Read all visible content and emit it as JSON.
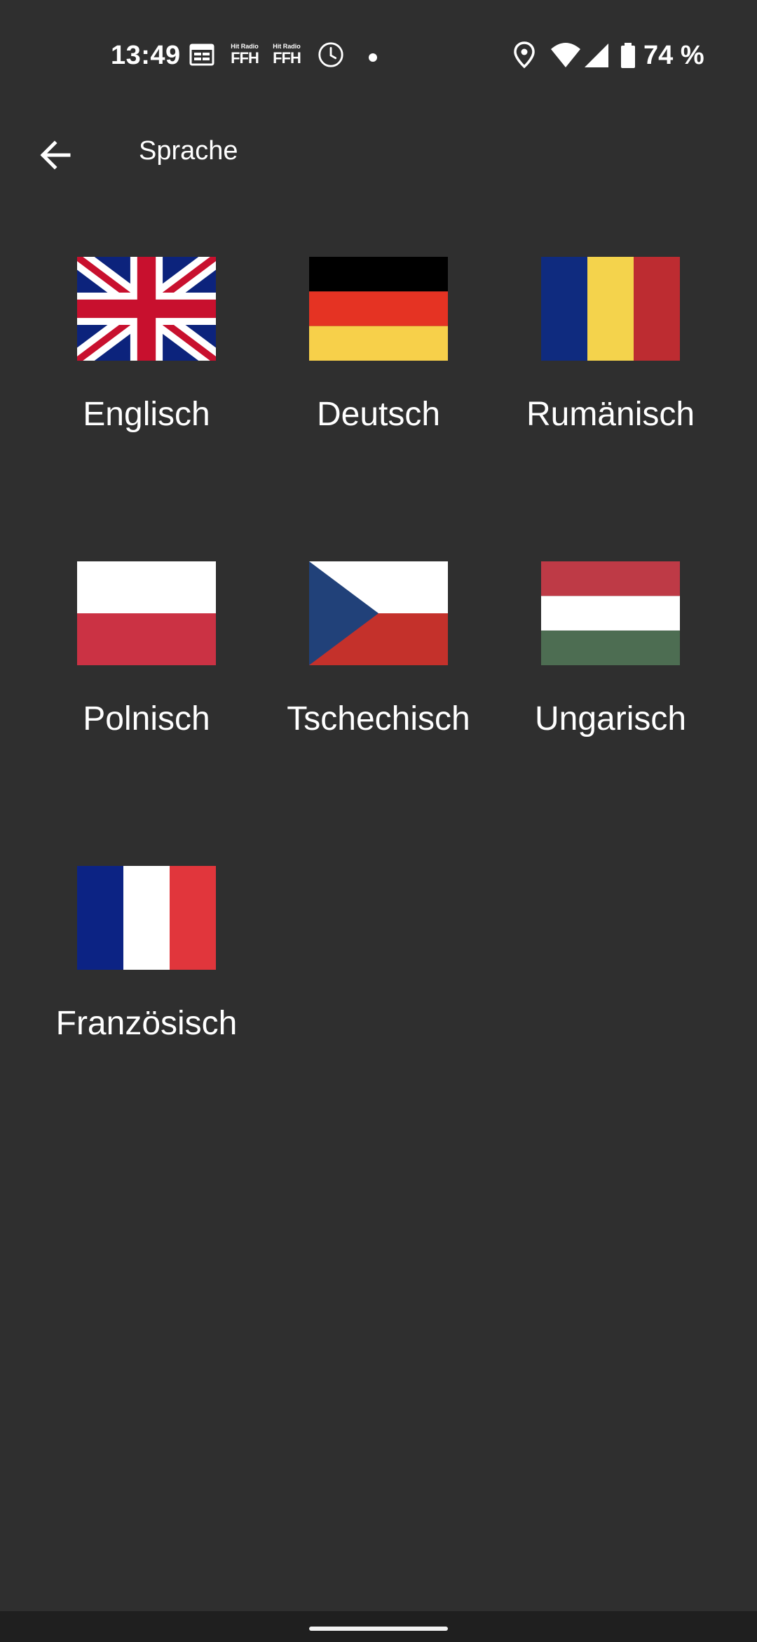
{
  "status_bar": {
    "time": "13:49",
    "notification_icons": [
      "calendar-icon",
      "hit-radio-ffh-icon",
      "hit-radio-ffh-icon",
      "alarm-clock-icon",
      "dot-icon"
    ],
    "ffh_small": "Hit Radio",
    "ffh_big": "FFH",
    "system_icons": [
      "location-icon",
      "wifi-icon",
      "signal-icon",
      "battery-icon"
    ],
    "battery": "74 %"
  },
  "toolbar": {
    "title": "Sprache",
    "back_icon": "arrow-back-icon"
  },
  "languages": [
    {
      "label": "Englisch",
      "flag": "uk"
    },
    {
      "label": "Deutsch",
      "flag": "de"
    },
    {
      "label": "Rumänisch",
      "flag": "ro"
    },
    {
      "label": "Polnisch",
      "flag": "pl"
    },
    {
      "label": "Tschechisch",
      "flag": "cz"
    },
    {
      "label": "Ungarisch",
      "flag": "hu"
    },
    {
      "label": "Französisch",
      "flag": "fr"
    }
  ],
  "colors": {
    "background": "#2f2f2f",
    "text": "#ffffff",
    "nav_bar": "#1f1f1f"
  }
}
